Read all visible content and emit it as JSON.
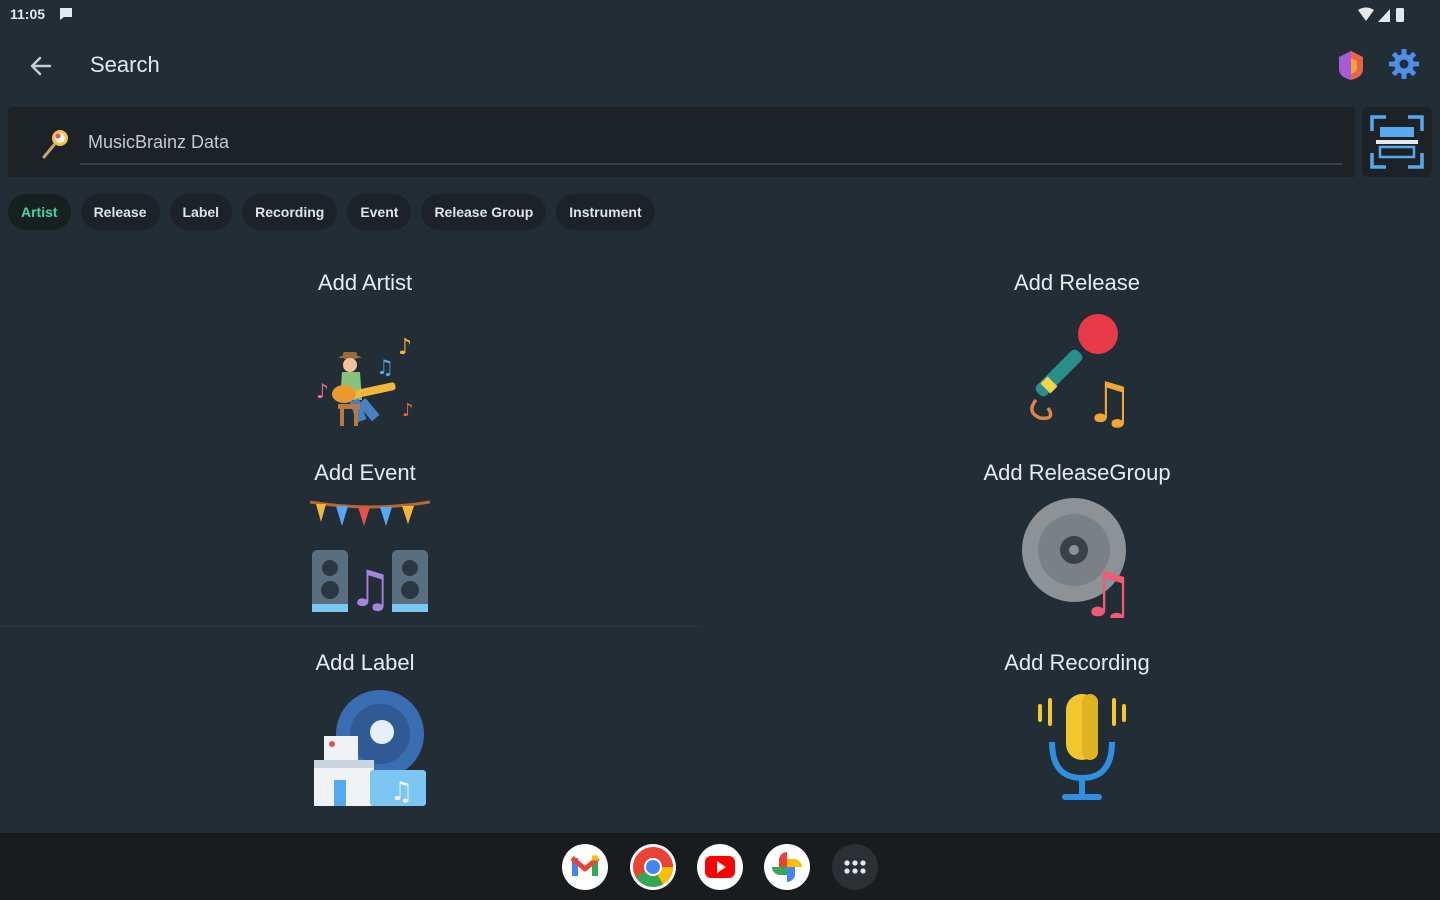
{
  "status_bar": {
    "time": "11:05"
  },
  "app_bar": {
    "title": "Search"
  },
  "search": {
    "placeholder": "MusicBrainz Data",
    "value": ""
  },
  "chips": [
    {
      "label": "Artist",
      "selected": true
    },
    {
      "label": "Release",
      "selected": false
    },
    {
      "label": "Label",
      "selected": false
    },
    {
      "label": "Recording",
      "selected": false
    },
    {
      "label": "Event",
      "selected": false
    },
    {
      "label": "Release Group",
      "selected": false
    },
    {
      "label": "Instrument",
      "selected": false
    }
  ],
  "tiles": [
    {
      "label": "Add Artist",
      "icon": "guitarist-icon"
    },
    {
      "label": "Add Release",
      "icon": "microphone-note-icon"
    },
    {
      "label": "Add Event",
      "icon": "concert-stage-icon"
    },
    {
      "label": "Add ReleaseGroup",
      "icon": "vinyl-note-icon"
    },
    {
      "label": "Add Label",
      "icon": "record-label-building-icon"
    },
    {
      "label": "Add Recording",
      "icon": "studio-microphone-icon"
    }
  ],
  "dock": [
    "gmail-icon",
    "chrome-icon",
    "youtube-icon",
    "photos-icon",
    "app-drawer-icon"
  ],
  "colors": {
    "background": "#222d36",
    "selected_chip_text": "#3dd6a6",
    "taskbar": "#181c1f"
  }
}
